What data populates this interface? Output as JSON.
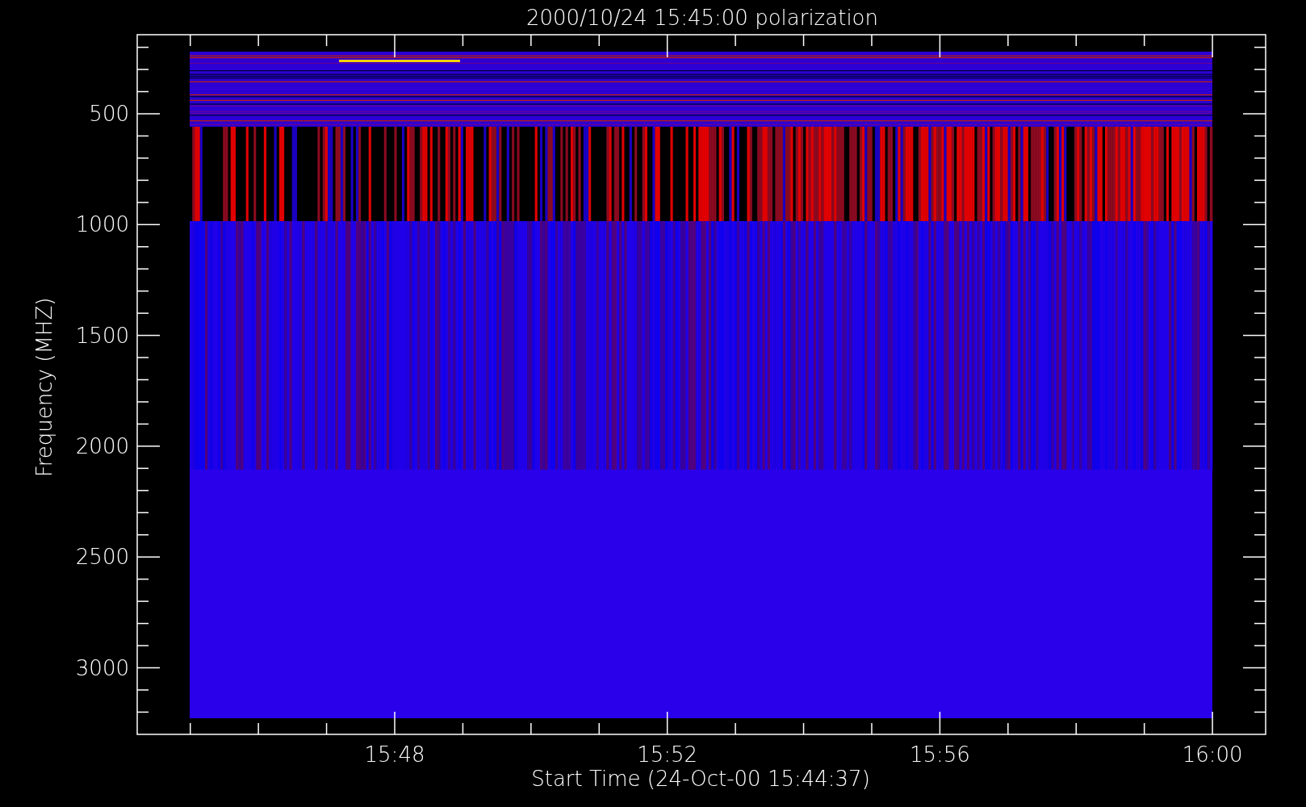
{
  "title": "2000/10/24 15:45:00 polarization",
  "x_axis": {
    "label": "Start Time (24-Oct-00 15:44:37)",
    "ticks": [
      "15:48",
      "15:52",
      "15:56",
      "16:00"
    ]
  },
  "y_axis": {
    "label": "Frequency (MHZ)",
    "ticks": [
      "500",
      "1000",
      "1500",
      "2000",
      "2500",
      "3000"
    ]
  }
}
